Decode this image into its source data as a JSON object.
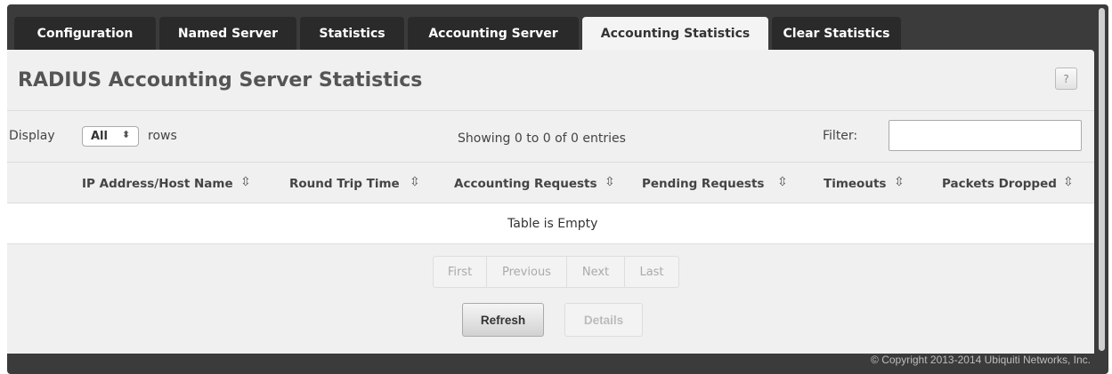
{
  "tabs": [
    {
      "label": "Configuration",
      "active": false
    },
    {
      "label": "Named Server",
      "active": false
    },
    {
      "label": "Statistics",
      "active": false
    },
    {
      "label": "Accounting Server",
      "active": false
    },
    {
      "label": "Accounting Statistics",
      "active": true
    },
    {
      "label": "Clear Statistics",
      "active": false
    }
  ],
  "page": {
    "title": "RADIUS Accounting Server Statistics",
    "help_label": "?"
  },
  "controls": {
    "display_label": "Display",
    "rows_select_value": "All",
    "rows_label": "rows",
    "info_text": "Showing 0 to 0 of 0 entries",
    "filter_label": "Filter:",
    "filter_value": ""
  },
  "table": {
    "columns": [
      "IP Address/Host Name",
      "Round Trip Time",
      "Accounting Requests",
      "Pending Requests",
      "Timeouts",
      "Packets Dropped"
    ],
    "sort_icon": "⇳",
    "empty_message": "Table is Empty"
  },
  "pager": {
    "first": "First",
    "previous": "Previous",
    "next": "Next",
    "last": "Last"
  },
  "buttons": {
    "refresh": "Refresh",
    "details": "Details"
  },
  "footer": {
    "copyright": "© Copyright 2013-2014 Ubiquiti Networks, Inc."
  },
  "colors": {
    "frame": "#3b3b3b",
    "tab_inactive": "#2a2a2a",
    "panel": "#f0f0f0"
  }
}
